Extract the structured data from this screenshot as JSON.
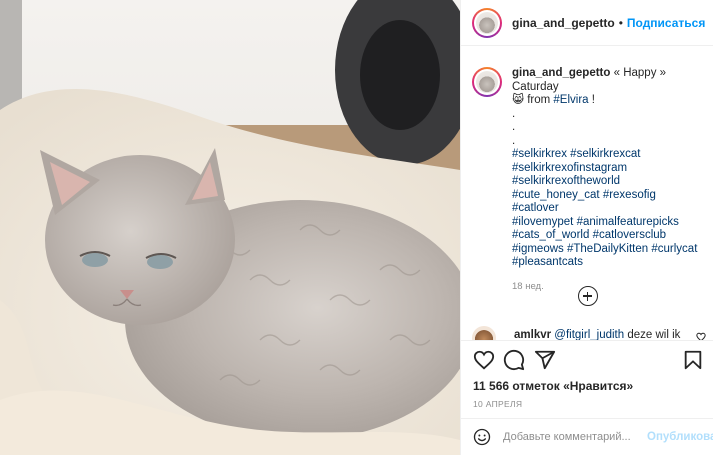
{
  "header": {
    "username": "gina_and_gepetto",
    "separator": "•",
    "follow_label": "Подписаться"
  },
  "caption": {
    "username": "gina_and_gepetto",
    "text_start": "« Happy » Caturday",
    "emoji": "😸",
    "from_text": "from",
    "from_tag": "#Elvira",
    "text_end": "!",
    "dots": [
      ".",
      ".",
      "."
    ],
    "hashtag_lines": [
      [
        "#selkirkrex",
        "#selkirkrexcat"
      ],
      [
        "#selkirkrexofinstagram"
      ],
      [
        "#selkirkrexoftheworld"
      ],
      [
        "#cute_honey_cat",
        "#rexesofig",
        "#catlover"
      ],
      [
        "#ilovemypet",
        "#animalfeaturepicks"
      ],
      [
        "#cats_of_world",
        "#catloversclub"
      ],
      [
        "#igmeows",
        "#TheDailyKitten",
        "#curlycat"
      ],
      [
        "#pleasantcats"
      ]
    ],
    "time": "18 нед."
  },
  "comment": {
    "username": "amlkvr",
    "mention": "@fitgirl_judith",
    "text": "deze wil ik"
  },
  "actions": {
    "likes_text": "11 566 отметок «Нравится»",
    "date": "10 АПРЕЛЯ"
  },
  "add_comment": {
    "placeholder": "Добавьте комментарий...",
    "publish_label": "Опубликовать"
  },
  "colors": {
    "link_blue": "#0095f6",
    "hashtag": "#00376b",
    "muted": "#8e8e8e",
    "publish_disabled": "#b2dffc"
  },
  "icons": [
    "heart-icon",
    "comment-icon",
    "share-icon",
    "bookmark-icon",
    "plus-circle-icon",
    "emoji-icon"
  ]
}
